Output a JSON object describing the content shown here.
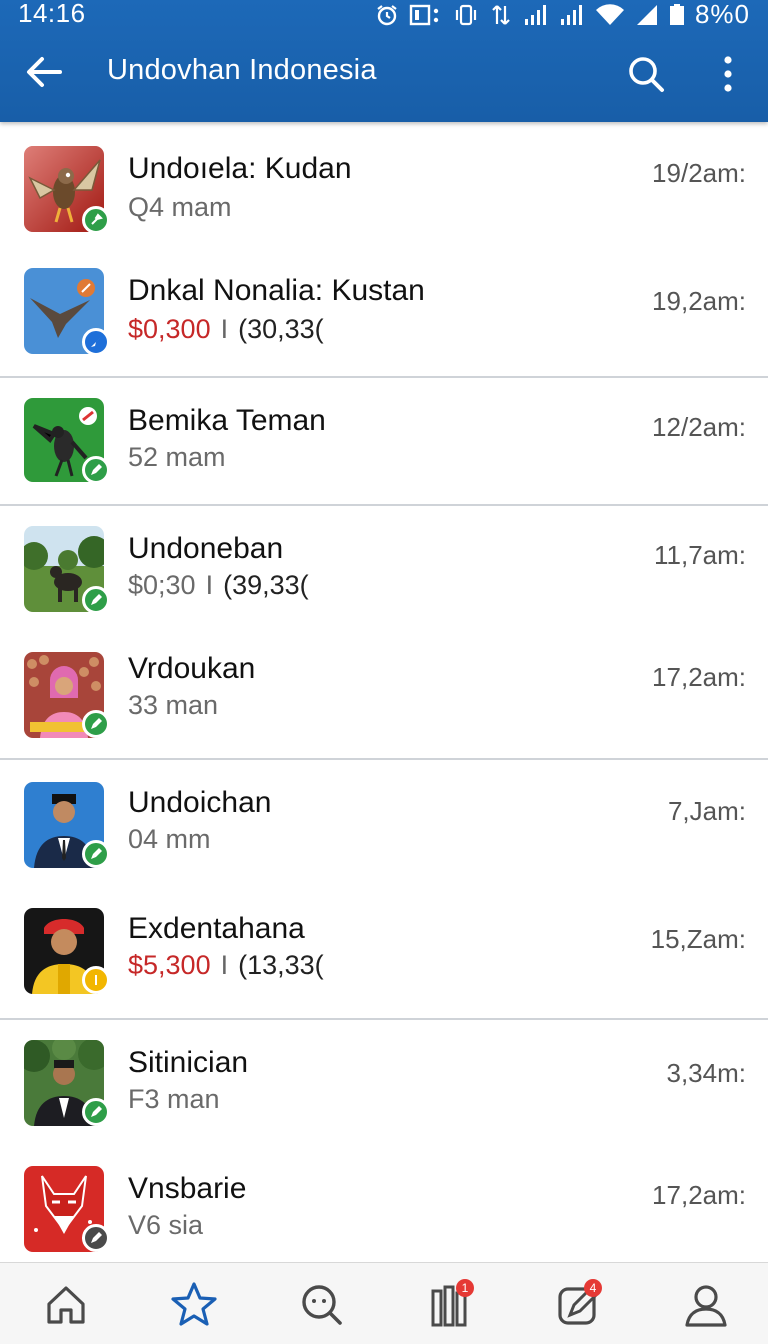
{
  "status": {
    "time": "14:16",
    "battery": "8%0"
  },
  "appbar": {
    "title": "Undovhan Indonesia"
  },
  "colors": {
    "appbar": "#1b63b0",
    "price_red": "#c62828",
    "badge_green": "#2e9e48",
    "badge_blue": "#1e6fd9",
    "badge_yellow": "#f2b600",
    "badge_dark": "#4a4a4a",
    "active_tab": "#1a5fb4"
  },
  "items": [
    {
      "name": "Undoıela: Kudan",
      "sub": "Q4 mam",
      "time": "19/2am:",
      "badge": "green",
      "icon": "bird-on-red-icon"
    },
    {
      "name": "Dnkal Nonalia: Kustan",
      "price": "$0,300",
      "sep": "I",
      "pair": "(30,33(",
      "time": "19,2am:",
      "badge": "blue",
      "icon": "bird-on-blue-icon"
    },
    {
      "name": "Bemika Teman",
      "sub": "52 mam",
      "time": "12/2am:",
      "badge": "green",
      "icon": "bird-on-green-icon"
    },
    {
      "name": "Undoneban",
      "price": "$0;30",
      "sep": "I",
      "pair": "(39,33(",
      "time": "11,7am:",
      "badge": "green",
      "icon": "animal-photo-icon",
      "price_grey": true
    },
    {
      "name": "Vrdoukan",
      "sub": "33 man",
      "time": "17,2am:",
      "badge": "green",
      "icon": "woman-photo-icon"
    },
    {
      "name": "Undoichan",
      "sub": "04 mm",
      "time": "7,Jam:",
      "badge": "green",
      "icon": "man-blue-photo-icon"
    },
    {
      "name": "Exdentahana",
      "price": "$5,300",
      "sep": "I",
      "pair": "(13,33(",
      "time": "15,Zam:",
      "badge": "yellow",
      "icon": "man-yellow-photo-icon"
    },
    {
      "name": "Sitinician",
      "sub": "F3 man",
      "time": "3,34m:",
      "badge": "green",
      "icon": "man-forest-photo-icon"
    },
    {
      "name": "Vnsbarie",
      "sub": "V6 sia",
      "time": "17,2am:",
      "badge": "dark",
      "icon": "fox-on-red-icon"
    }
  ],
  "bottom_nav": [
    {
      "name": "home",
      "icon": "home-icon"
    },
    {
      "name": "favorites",
      "icon": "star-icon",
      "active": true
    },
    {
      "name": "search",
      "icon": "search-icon"
    },
    {
      "name": "library",
      "icon": "library-icon",
      "badge": "1"
    },
    {
      "name": "compose",
      "icon": "compose-icon",
      "badge": "4"
    },
    {
      "name": "profile",
      "icon": "profile-icon"
    }
  ]
}
